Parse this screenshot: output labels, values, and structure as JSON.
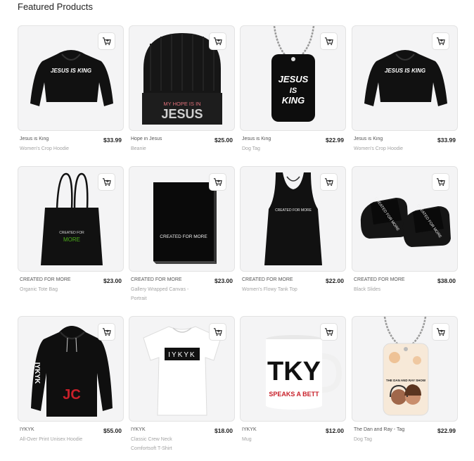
{
  "section": {
    "title": "Featured Products"
  },
  "products": [
    {
      "name": "Jesus is King",
      "type": "Women's Crop Hoodie",
      "price": "$33.99",
      "art_text": "JESUS IS KING"
    },
    {
      "name": "Hope in Jesus",
      "type": "Beanie",
      "price": "$25.00",
      "art_text_1": "MY HOPE IS IN",
      "art_text_2": "JESUS"
    },
    {
      "name": "Jesus is King",
      "type": "Dog Tag",
      "price": "$22.99",
      "art_text_1": "JESUS",
      "art_text_2": "IS",
      "art_text_3": "KING"
    },
    {
      "name": "Jesus is King",
      "type": "Women's Crop Hoodie",
      "price": "$33.99",
      "art_text": "JESUS IS KING"
    },
    {
      "name": "CREATED FOR MORE",
      "type": "Organic Tote Bag",
      "price": "$23.00",
      "art_text_1": "CREATED FOR",
      "art_text_2": "MORE"
    },
    {
      "name": "CREATED FOR MORE",
      "type": "Gallery Wrapped Canvas - Portrait",
      "price": "$23.00",
      "art_text": "CREATED FOR MORE"
    },
    {
      "name": "CREATED FOR MORE",
      "type": "Women's Flowy Tank Top",
      "price": "$22.00",
      "art_text": "CREATED FOR MORE"
    },
    {
      "name": "CREATED FOR MORE",
      "type": "Black Slides",
      "price": "$38.00",
      "art_text": "CREATED FOR MORE"
    },
    {
      "name": "IYKYK",
      "type": "All-Over Print Unisex Hoodie",
      "price": "$55.00",
      "art_text": "JC",
      "art_text_2": "IYKYK"
    },
    {
      "name": "IYKYK",
      "type": "Classic Crew Neck Comfortsoft T-Shirt",
      "price": "$18.00",
      "art_text": "IYKYK"
    },
    {
      "name": "IYKYK",
      "type": "Mug",
      "price": "$12.00",
      "art_text_1": "TKY",
      "art_text_2": "SPEAKS A BETT"
    },
    {
      "name": "The Dan and Ray - Tag",
      "type": "Dog Tag",
      "price": "$22.99",
      "art_text": "THE DAN AND RAY SHOW"
    }
  ],
  "icons": {
    "cart": "add-to-cart-icon"
  },
  "colors": {
    "card_bg": "#f4f4f5",
    "card_border": "#e3e3e3",
    "price": "#222222",
    "muted": "#a3a3a3",
    "accent_green": "#4caf1a",
    "accent_red": "#c8202a"
  }
}
